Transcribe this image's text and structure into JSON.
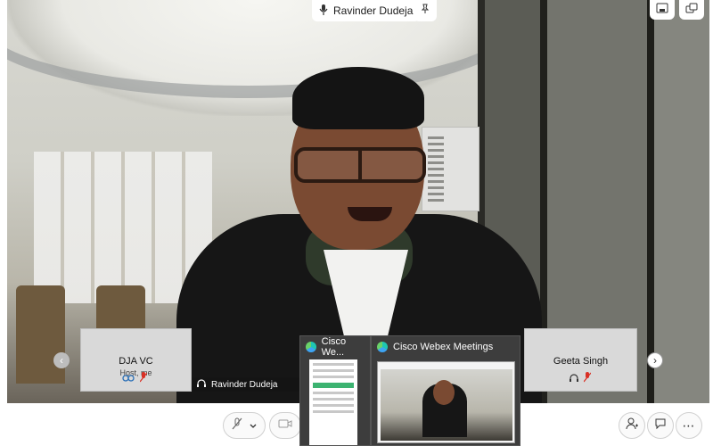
{
  "active_speaker": {
    "name": "Ravinder Dudeja"
  },
  "participants": [
    {
      "name": "DJA VC",
      "role": "Host, me"
    },
    {
      "name": "Ravinder Dudeja"
    },
    {
      "name": "Geeta Singh"
    }
  ],
  "taskbar": {
    "thumb1_title": "Cisco We...",
    "thumb2_title": "Cisco Webex Meetings"
  },
  "icons": {
    "pin": "pin-icon",
    "layout": "layout-icon",
    "popout": "popout-icon",
    "mute": "mic-muted-icon",
    "video": "video-icon",
    "participants": "participants-icon",
    "chat": "chat-icon",
    "more": "more-icon",
    "prev": "chevron-left-icon",
    "next": "chevron-right-icon"
  },
  "colors": {
    "mute_red": "#d93025",
    "webex_teal": "#1ec6b3"
  }
}
